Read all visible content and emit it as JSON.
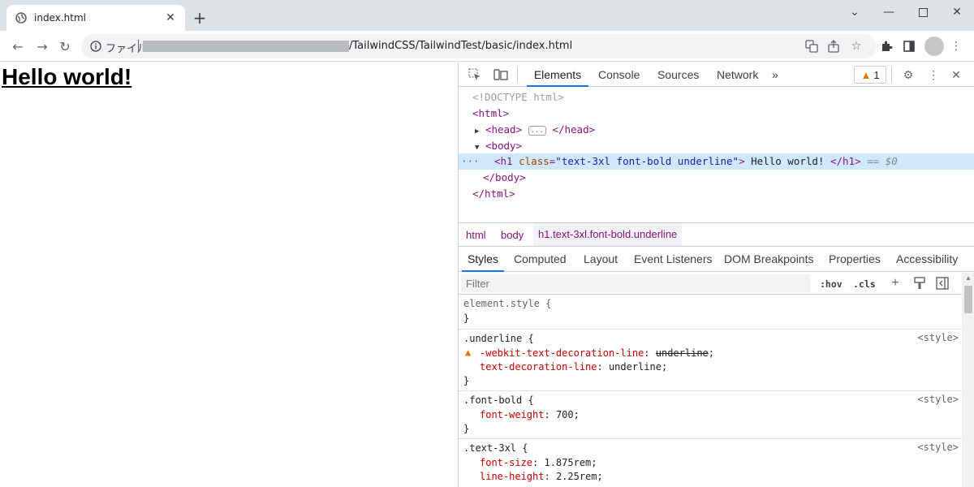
{
  "browser": {
    "tab_title": "index.html",
    "new_tab_label": "+",
    "url_label": "ファイル",
    "url_path": "/TailwindCSS/TailwindTest/basic/index.html"
  },
  "page": {
    "heading": "Hello world!"
  },
  "devtools": {
    "tabs": [
      "Elements",
      "Console",
      "Sources",
      "Network"
    ],
    "more_tabs": "»",
    "warning_count": "1",
    "dom": {
      "doctype": "<!DOCTYPE html>",
      "html_open": "<html>",
      "head_open": "<head>",
      "head_close": "</head>",
      "body_open": "<body>",
      "h1_tag": "h1",
      "h1_attr_name": "class",
      "h1_attr_value": "\"text-3xl font-bold underline\"",
      "h1_text": "Hello world!",
      "h1_close": "</h1>",
      "h1_suffix": "== $0",
      "body_close": "</body>",
      "html_close": "</html>",
      "ellipsis": "..."
    },
    "breadcrumbs": [
      "html",
      "body",
      "h1.text-3xl.font-bold.underline"
    ],
    "subtabs": [
      "Styles",
      "Computed",
      "Layout",
      "Event Listeners",
      "DOM Breakpoints",
      "Properties",
      "Accessibility"
    ],
    "filter_placeholder": "Filter",
    "hov": ":hov",
    "cls": ".cls",
    "styles": {
      "element_style": "element.style {",
      "close_brace": "}",
      "source": "<style>",
      "underline_selector": ".underline {",
      "underline_decl1_name": "-webkit-text-decoration-line",
      "underline_decl1_value": "underline",
      "underline_decl2_name": "text-decoration-line",
      "underline_decl2_value": "underline",
      "bold_selector": ".font-bold {",
      "bold_decl_name": "font-weight",
      "bold_decl_value": "700",
      "xl_selector": ".text-3xl {",
      "xl_decl1_name": "font-size",
      "xl_decl1_value": "1.875rem",
      "xl_decl2_name": "line-height",
      "xl_decl2_value": "2.25rem"
    }
  }
}
